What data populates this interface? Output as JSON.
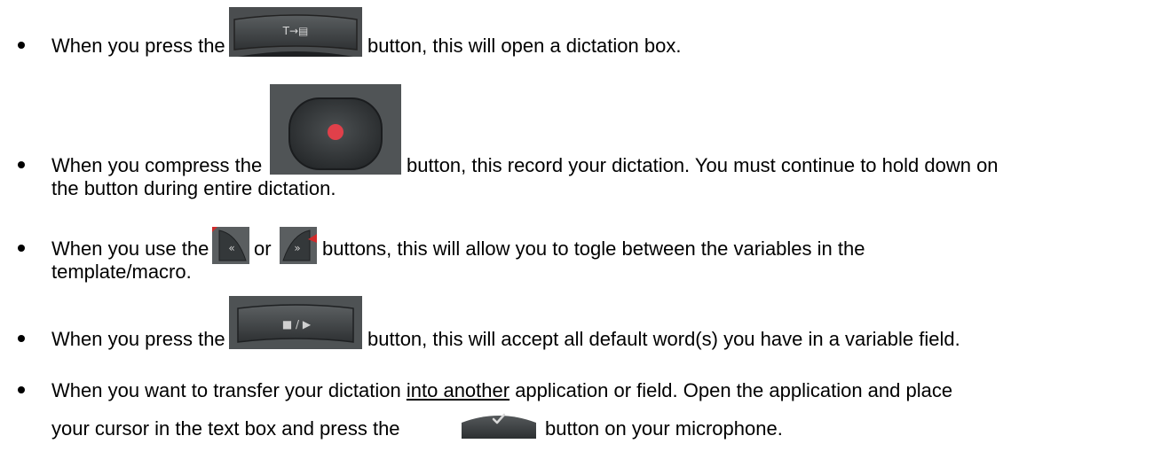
{
  "items": [
    {
      "before": "When you press the",
      "after": "button, this will open a dictation box."
    },
    {
      "before": "When you compress the",
      "after": "button, this record your dictation. You must continue to hold down on",
      "line2": "the button during entire dictation."
    },
    {
      "before": "When you use the",
      "middle": "or",
      "after": "buttons, this will allow you to togle between the variables in the",
      "line2": "template/macro."
    },
    {
      "before": "When you press the",
      "after": "button, this will accept all default word(s) you have in a variable field."
    },
    {
      "pre": "When you want to transfer your dictation ",
      "underlined": "into another",
      "post": " application or field. Open the application and place",
      "line2_before": "your cursor in the text box and press the",
      "line2_after": "button on your microphone."
    }
  ],
  "buttons": {
    "transcribe": "T→▤",
    "stop_play": "■ / ▶"
  },
  "colors": {
    "button_dark": "#3a3d3f",
    "button_light": "#6a6e70",
    "record_red": "#e0404a",
    "check_gray": "#d9d9d9"
  }
}
